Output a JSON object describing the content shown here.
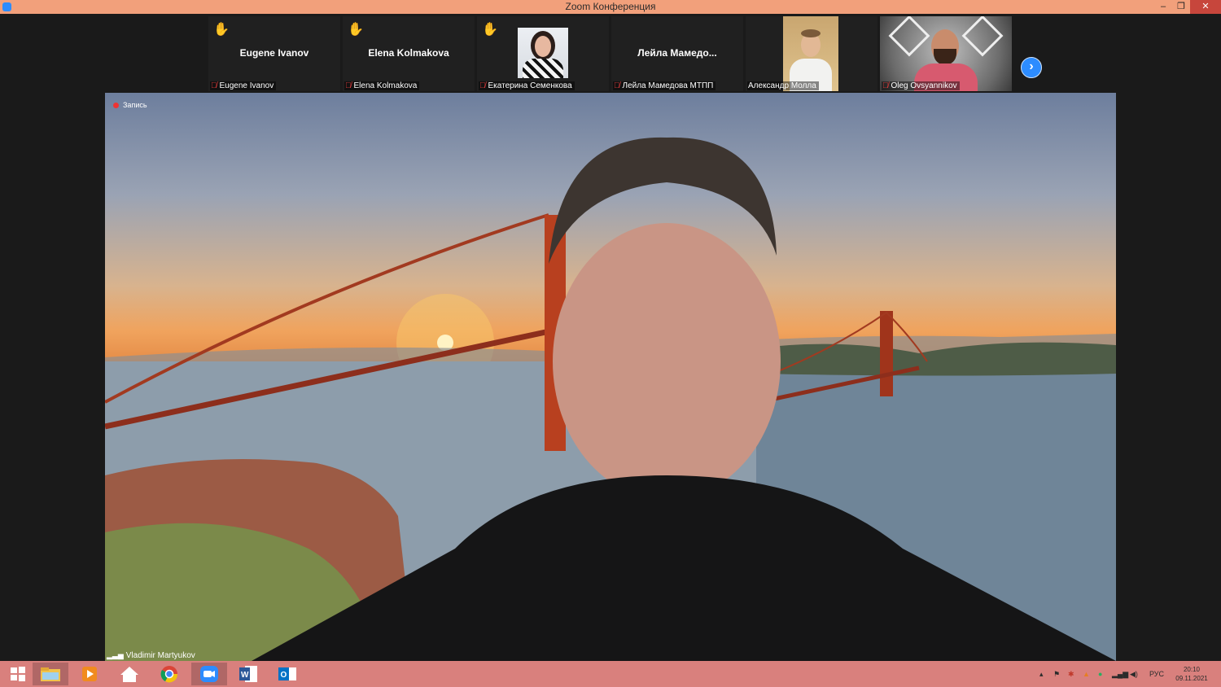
{
  "window": {
    "title": "Zoom Конференция",
    "minimize_glyph": "–",
    "maximize_glyph": "❐",
    "close_glyph": "✕"
  },
  "participants": [
    {
      "center_name": "Eugene Ivanov",
      "label": "Eugene Ivanov",
      "hand_raised": true,
      "muted": true,
      "video": false
    },
    {
      "center_name": "Elena Kolmakova",
      "label": "Elena Kolmakova",
      "hand_raised": true,
      "muted": true,
      "video": false
    },
    {
      "center_name": "",
      "label": "Екатерина Семенкова",
      "hand_raised": true,
      "muted": true,
      "video": true
    },
    {
      "center_name": "Лейла  Мамедо...",
      "label": "Лейла Мамедова МТПП",
      "hand_raised": false,
      "muted": true,
      "video": false
    },
    {
      "center_name": "",
      "label": "Александр Молла",
      "hand_raised": false,
      "muted": false,
      "video": true
    },
    {
      "center_name": "",
      "label": "Oleg Ovsyannikov",
      "hand_raised": false,
      "muted": true,
      "video": true
    }
  ],
  "next_page_glyph": "›",
  "main_video": {
    "recording_label": "Запись",
    "speaker_name": "Vladimir Martyukov"
  },
  "taskbar": {
    "language": "РУС",
    "time": "20:10",
    "date": "09.11.2021",
    "apps": [
      "start-icon",
      "file-explorer-icon",
      "media-player-icon",
      "home-icon",
      "chrome-icon",
      "zoom-icon",
      "word-icon",
      "outlook-icon"
    ]
  },
  "colors": {
    "titlebar": "#f2a07b",
    "taskbar": "#d9807d",
    "accent": "#2d8cff",
    "mute_red": "#e03c3c",
    "hand_yellow": "#f5c242"
  }
}
